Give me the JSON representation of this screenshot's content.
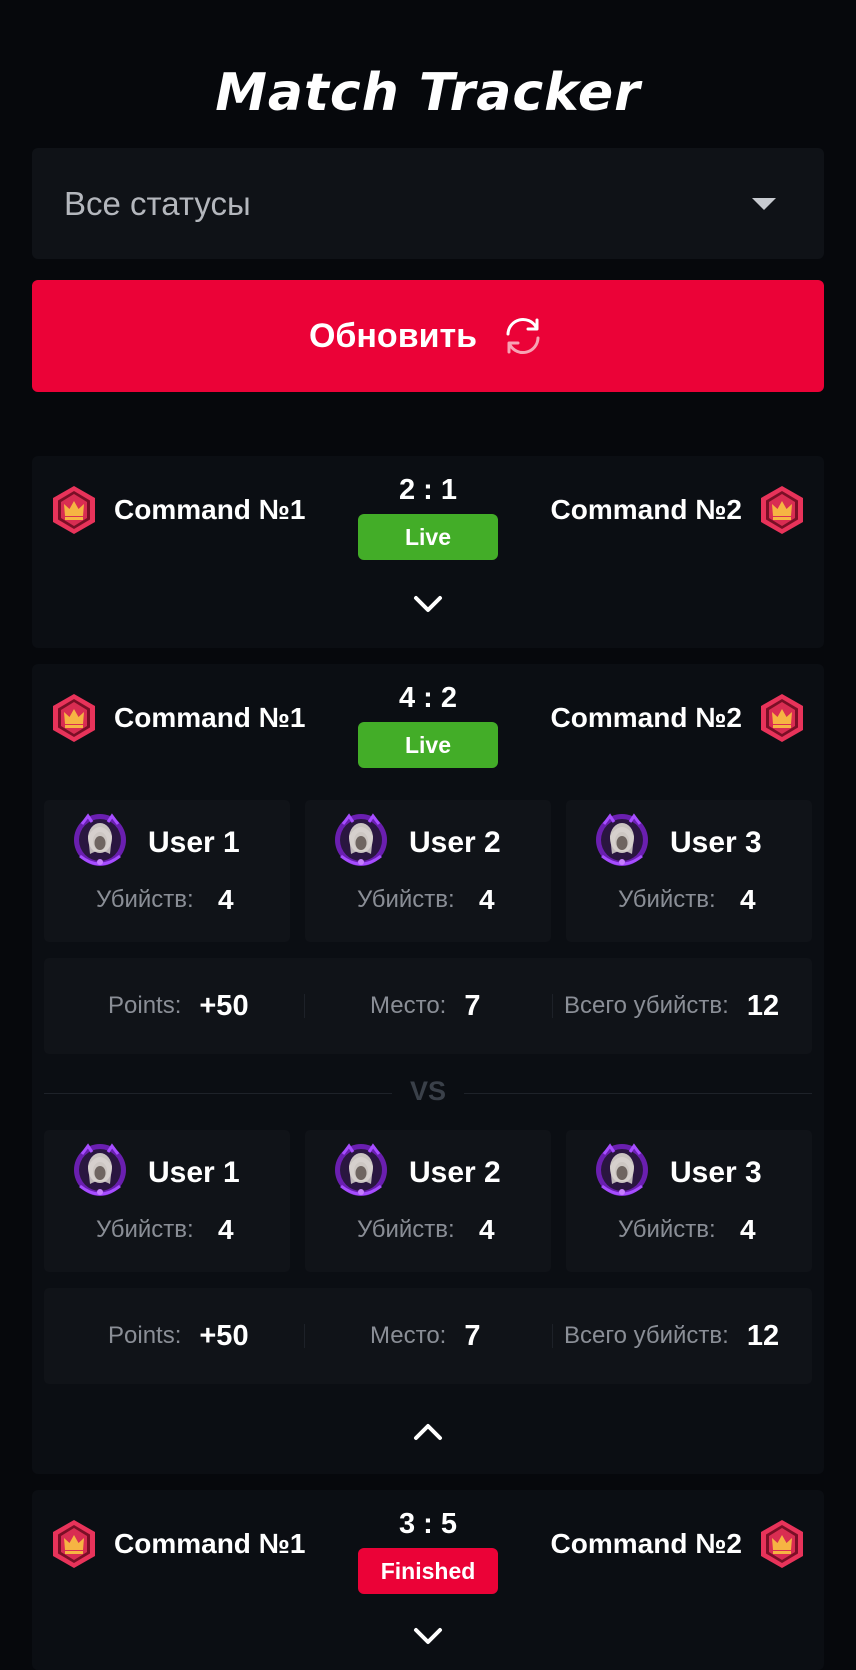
{
  "app": {
    "title": "Match Tracker"
  },
  "filter": {
    "selected": "Все статусы"
  },
  "refresh": {
    "label": "Обновить"
  },
  "colors": {
    "accent": "#eb0237",
    "live": "#43ad28",
    "finished": "#eb0237"
  },
  "matches": [
    {
      "team1": "Command №1",
      "team2": "Command №2",
      "score": "2 : 1",
      "status": "Live",
      "expanded": false
    },
    {
      "team1": "Command №1",
      "team2": "Command №2",
      "score": "4 : 2",
      "status": "Live",
      "expanded": true,
      "teams": [
        {
          "players": [
            {
              "name": "User 1",
              "kills_label": "Убийств:",
              "kills": "4"
            },
            {
              "name": "User 2",
              "kills_label": "Убийств:",
              "kills": "4"
            },
            {
              "name": "User 3",
              "kills_label": "Убийств:",
              "kills": "4"
            }
          ],
          "stats": {
            "points_label": "Points:",
            "points": "+50",
            "place_label": "Место:",
            "place": "7",
            "total_label": "Всего убийств:",
            "total": "12"
          }
        },
        {
          "players": [
            {
              "name": "User 1",
              "kills_label": "Убийств:",
              "kills": "4"
            },
            {
              "name": "User 2",
              "kills_label": "Убийств:",
              "kills": "4"
            },
            {
              "name": "User 3",
              "kills_label": "Убийств:",
              "kills": "4"
            }
          ],
          "stats": {
            "points_label": "Points:",
            "points": "+50",
            "place_label": "Место:",
            "place": "7",
            "total_label": "Всего убийств:",
            "total": "12"
          }
        }
      ],
      "vs_label": "VS"
    },
    {
      "team1": "Command №1",
      "team2": "Command №2",
      "score": "3 : 5",
      "status": "Finished",
      "expanded": false
    }
  ],
  "icons": {
    "team": "crown-hexagon-icon",
    "refresh": "refresh-icon",
    "avatar": "player-avatar",
    "expand": "chevron-down-icon",
    "collapse": "chevron-up-icon",
    "dropdown": "caret-down-icon"
  }
}
